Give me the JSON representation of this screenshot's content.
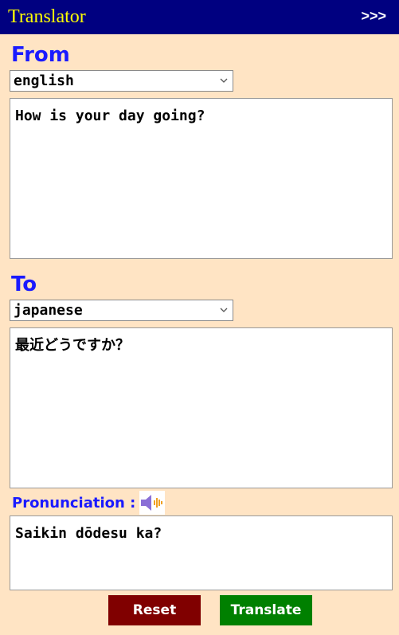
{
  "app": {
    "title": "Translator",
    "expand_label": ">>>"
  },
  "from": {
    "label": "From",
    "language": "english",
    "text": "How is your day going?"
  },
  "to": {
    "label": "To",
    "language": "japanese",
    "text": "最近どうですか？"
  },
  "pronunciation": {
    "label": "Pronunciation :",
    "text": "Saikin dōdesu ka?",
    "icon": "speaker-icon"
  },
  "buttons": {
    "reset_label": "Reset",
    "translate_label": "Translate"
  },
  "colors": {
    "background": "#ffe4c4",
    "titlebar": "#000080",
    "title_text": "#ffff00",
    "label_blue": "#1a1aff",
    "reset": "#800000",
    "translate": "#008000"
  }
}
